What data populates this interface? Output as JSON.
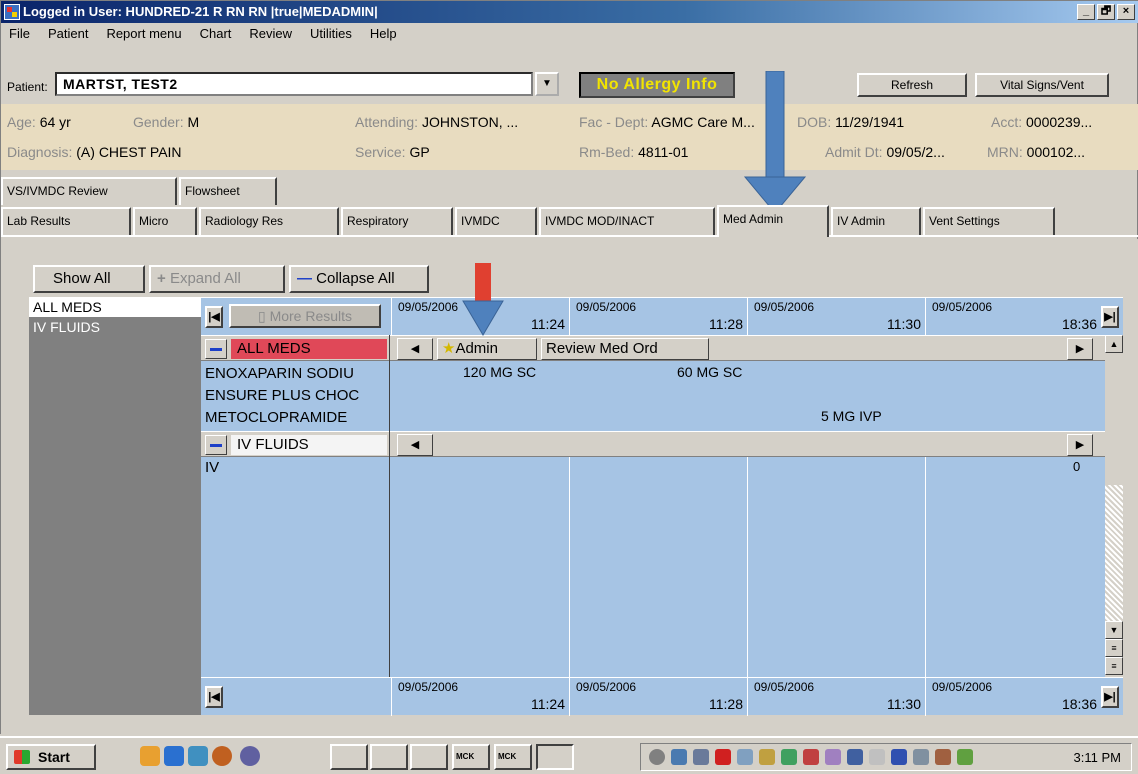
{
  "window": {
    "title": "Logged in User: HUNDRED-21 R RN RN |true|MEDADMIN|",
    "buttons": [
      "_",
      "🗗",
      "×"
    ]
  },
  "menu": [
    "File",
    "Patient",
    "Report menu",
    "Chart",
    "Review",
    "Utilities",
    "Help"
  ],
  "patient_bar": {
    "label": "Patient:",
    "patient_name": "MARTST, TEST2",
    "allergy": "No Allergy Info",
    "refresh": "Refresh",
    "vital_signs": "Vital Signs/Vent"
  },
  "info": {
    "age_label": "Age:",
    "age": "64 yr",
    "gender_label": "Gender:",
    "gender": "M",
    "attending_label": "Attending:",
    "attending": "JOHNSTON, ...",
    "fac_label": "Fac - Dept:",
    "fac": "AGMC Care M...",
    "dob_label": "DOB:",
    "dob": "11/29/1941",
    "acct_label": "Acct:",
    "acct": "0000239...",
    "diagnosis_label": "Diagnosis:",
    "diagnosis": "(A) CHEST PAIN",
    "service_label": "Service:",
    "service": "GP",
    "rmbed_label": "Rm-Bed:",
    "rmbed": "4811-01",
    "admit_label": "Admit Dt:",
    "admit": "09/05/2...",
    "mrn_label": "MRN:",
    "mrn": "000102..."
  },
  "tabs_row1": [
    "VS/IVMDC Review",
    "Flowsheet"
  ],
  "tabs_row2": [
    "Lab Results",
    "Micro",
    "Radiology Res",
    "Respiratory",
    "IVMDC",
    "IVMDC MOD/INACT",
    "Med Admin",
    "IV Admin",
    "Vent Settings"
  ],
  "active_tab": "Med Admin",
  "toolbar": {
    "show_all": "Show All",
    "expand_all": "Expand All",
    "collapse_all": "Collapse All"
  },
  "left_list": [
    "ALL MEDS",
    "IV FLUIDS"
  ],
  "grid": {
    "more_results": "More Results",
    "columns": [
      {
        "date": "09/05/2006",
        "time": "11:24"
      },
      {
        "date": "09/05/2006",
        "time": "11:28"
      },
      {
        "date": "09/05/2006",
        "time": "11:30"
      },
      {
        "date": "09/05/2006",
        "time": "18:36"
      }
    ],
    "section_all_meds": "ALL MEDS",
    "admin_btn": "Admin",
    "review_btn": "Review Med Ord",
    "meds": [
      {
        "name": "ENOXAPARIN SODIU",
        "values": [
          "120 MG SC",
          "60 MG SC",
          "",
          ""
        ]
      },
      {
        "name": "ENSURE PLUS CHOC",
        "values": [
          "",
          "",
          "",
          ""
        ]
      },
      {
        "name": "METOCLOPRAMIDE",
        "values": [
          "",
          "",
          "5 MG IVP",
          ""
        ]
      }
    ],
    "section_iv": "IV FLUIDS",
    "iv_rows": [
      {
        "name": "IV",
        "trailing": "0"
      }
    ]
  },
  "taskbar": {
    "start": "Start",
    "task_labels": [
      "",
      "",
      "",
      "MCK",
      "MCK",
      ""
    ],
    "clock": "3:11 PM"
  }
}
